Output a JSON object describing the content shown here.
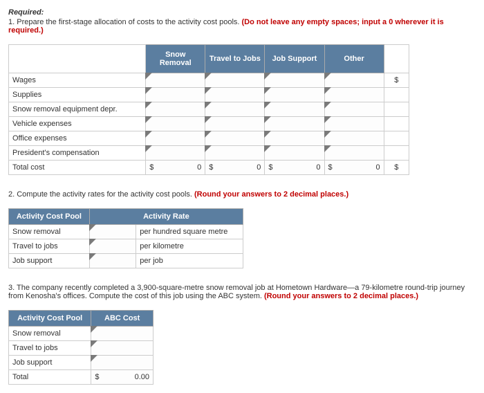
{
  "heading": "Required:",
  "q1": {
    "prefix": "1. Prepare the first-stage allocation of costs to the activity cost pools. ",
    "red": "(Do not leave any empty spaces; input a 0 wherever it is required.)"
  },
  "t1": {
    "headers": [
      "Snow Removal",
      "Travel to Jobs",
      "Job Support",
      "Other"
    ],
    "rows": [
      "Wages",
      "Supplies",
      "Snow removal equipment depr.",
      "Vehicle expenses",
      "Office expenses",
      "President's compensation",
      "Total cost"
    ],
    "total_sym": "$",
    "total_val": "0",
    "right_sym": "$"
  },
  "q2": {
    "prefix": "2. Compute the activity rates for the activity cost pools. ",
    "red": "(Round your answers to 2 decimal places.)"
  },
  "t2": {
    "h1": "Activity Cost Pool",
    "h2": "Activity Rate",
    "rows": [
      {
        "label": "Snow removal",
        "unit": "per hundred square metre"
      },
      {
        "label": "Travel to jobs",
        "unit": "per kilometre"
      },
      {
        "label": "Job support",
        "unit": "per job"
      }
    ]
  },
  "q3": {
    "prefix": "3. The company recently completed a 3,900-square-metre snow removal job at Hometown Hardware—a 79-kilometre round-trip journey from Kenosha's offices. Compute the cost of this job using the ABC system. ",
    "red": "(Round your answers to 2 decimal places.)"
  },
  "t3": {
    "h1": "Activity Cost Pool",
    "h2": "ABC Cost",
    "rows": [
      "Snow removal",
      "Travel to jobs",
      "Job support",
      "Total"
    ],
    "total_sym": "$",
    "total_val": "0.00"
  }
}
